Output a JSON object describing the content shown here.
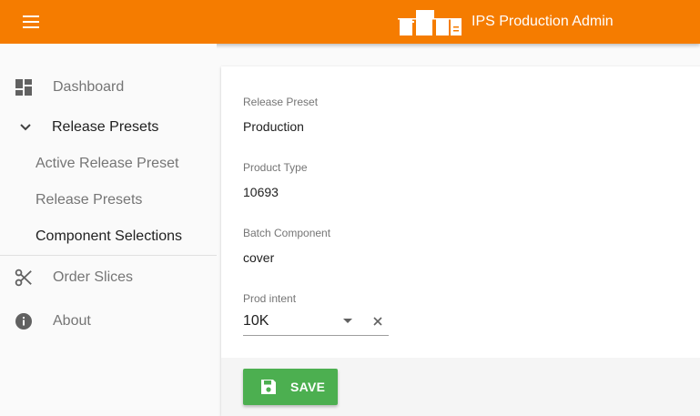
{
  "header": {
    "title": "IPS Production Admin",
    "menu_icon": "hamburger-menu-icon",
    "logo": "ips-logo",
    "background_color": "#f57c00"
  },
  "sidebar": {
    "items": [
      {
        "label": "Dashboard",
        "icon": "dashboard-icon"
      },
      {
        "label": "Release Presets",
        "icon": "chevron-down-icon",
        "expanded": true,
        "children": [
          {
            "label": "Active Release Preset"
          },
          {
            "label": "Release Presets"
          },
          {
            "label": "Component Selections",
            "active": true
          }
        ]
      },
      {
        "label": "Order Slices",
        "icon": "scissors-icon"
      },
      {
        "label": "About",
        "icon": "info-icon"
      }
    ]
  },
  "form": {
    "release_preset": {
      "label": "Release Preset",
      "value": "Production"
    },
    "product_type": {
      "label": "Product Type",
      "value": "10693"
    },
    "batch_component": {
      "label": "Batch Component",
      "value": "cover"
    },
    "prod_intent": {
      "label": "Prod intent",
      "value": "10K"
    },
    "save_label": "SAVE",
    "save_color": "#4caf50"
  }
}
